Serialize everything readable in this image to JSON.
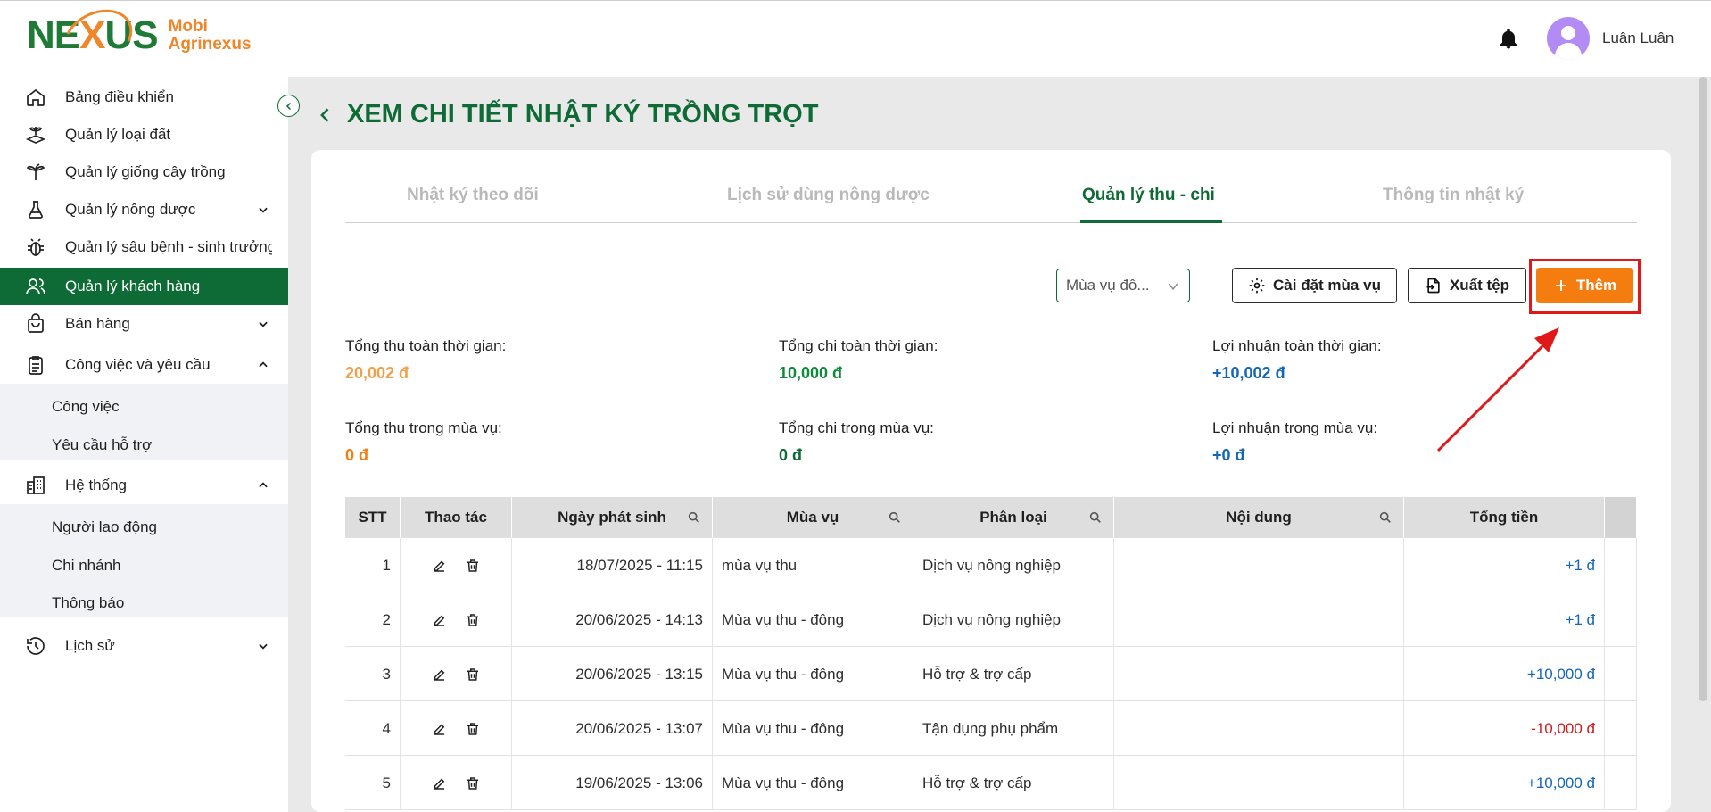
{
  "brand": {
    "word_left": "NE",
    "word_x": "X",
    "word_right": "US",
    "line1": "Mobi",
    "line2": "Agrinexus"
  },
  "user": {
    "name": "Luân Luân"
  },
  "sidebar": {
    "items": [
      {
        "label": "Bảng điều khiển",
        "icon": "home-icon"
      },
      {
        "label": "Quản lý loại đất",
        "icon": "soil-icon"
      },
      {
        "label": "Quản lý giống cây trồng",
        "icon": "plant-icon"
      },
      {
        "label": "Quản lý nông dược",
        "icon": "flask-icon"
      },
      {
        "label": "Quản lý sâu bệnh - sinh trưởng",
        "icon": "bug-icon"
      },
      {
        "label": "Quản lý khách hàng",
        "icon": "users-icon"
      },
      {
        "label": "Bán hàng",
        "icon": "bag-icon"
      },
      {
        "label": "Công việc và yêu cầu",
        "icon": "clipboard-icon"
      },
      {
        "label": "Hệ thống",
        "icon": "building-icon"
      },
      {
        "label": "Lịch sử",
        "icon": "history-icon"
      }
    ],
    "work_sub": [
      "Công việc",
      "Yêu cầu hỗ trợ"
    ],
    "system_sub": [
      "Người lao động",
      "Chi nhánh",
      "Thông báo"
    ]
  },
  "page": {
    "title": "XEM CHI TIẾT NHẬT KÝ TRỒNG TRỌT"
  },
  "tabs": [
    "Nhật ký theo dõi",
    "Lịch sử dùng nông dược",
    "Quản lý thu - chi",
    "Thông tin nhật ký"
  ],
  "active_tab": "Quản lý thu - chi",
  "toolbar": {
    "season_value": "Mùa vụ đô...",
    "settings_label": "Cài đặt mùa vụ",
    "export_label": "Xuất tệp",
    "add_label": "Thêm"
  },
  "stats": {
    "total_income_all_label": "Tổng thu toàn thời gian:",
    "total_income_all": "20,002 đ",
    "total_expense_all_label": "Tổng chi toàn thời gian:",
    "total_expense_all": "10,000 đ",
    "profit_all_label": "Lợi nhuận toàn thời gian:",
    "profit_all": "+10,002 đ",
    "total_income_season_label": "Tổng thu trong mùa vụ:",
    "total_income_season": "0 đ",
    "total_expense_season_label": "Tổng chi trong mùa vụ:",
    "total_expense_season": "0 đ",
    "profit_season_label": "Lợi nhuận trong mùa vụ:",
    "profit_season": "+0 đ"
  },
  "table": {
    "headers": [
      "STT",
      "Thao tác",
      "Ngày phát sinh",
      "Mùa vụ",
      "Phân loại",
      "Nội dung",
      "Tổng tiền"
    ],
    "rows": [
      {
        "stt": "1",
        "date": "18/07/2025 - 11:15",
        "season": "mùa vụ thu",
        "category": "Dịch vụ nông nghiệp",
        "content": "",
        "total": "+1 đ",
        "sign": "pos"
      },
      {
        "stt": "2",
        "date": "20/06/2025 - 14:13",
        "season": "Mùa vụ thu - đông",
        "category": "Dịch vụ nông nghiệp",
        "content": "",
        "total": "+1 đ",
        "sign": "pos"
      },
      {
        "stt": "3",
        "date": "20/06/2025 - 13:15",
        "season": "Mùa vụ thu - đông",
        "category": "Hỗ trợ & trợ cấp",
        "content": "",
        "total": "+10,000 đ",
        "sign": "pos"
      },
      {
        "stt": "4",
        "date": "20/06/2025 - 13:07",
        "season": "Mùa vụ thu - đông",
        "category": "Tận dụng phụ phẩm",
        "content": "",
        "total": "-10,000 đ",
        "sign": "neg"
      },
      {
        "stt": "5",
        "date": "19/06/2025 - 13:06",
        "season": "Mùa vụ thu - đông",
        "category": "Hỗ trợ & trợ cấp",
        "content": "",
        "total": "+10,000 đ",
        "sign": "pos"
      }
    ]
  },
  "colors": {
    "brand_green": "#0e6b35",
    "accent_orange": "#f57c0e",
    "highlight_red": "#e11818",
    "positive": "#1466b8",
    "negative": "#d11a1a"
  }
}
